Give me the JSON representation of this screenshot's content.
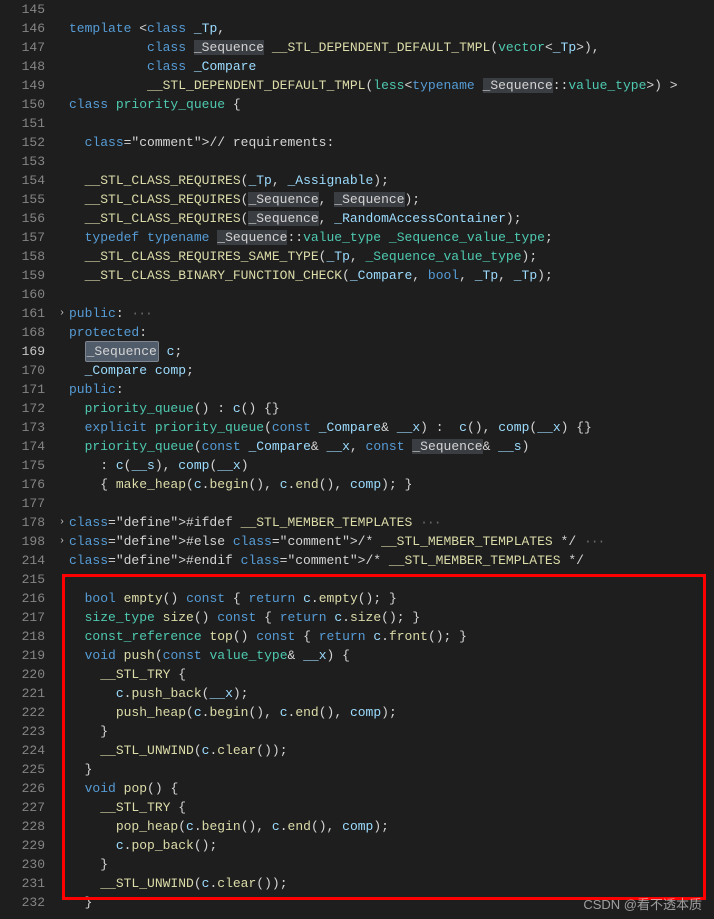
{
  "line_numbers": [
    145,
    146,
    147,
    148,
    149,
    150,
    151,
    152,
    153,
    154,
    155,
    156,
    157,
    158,
    159,
    160,
    161,
    168,
    169,
    170,
    171,
    172,
    173,
    174,
    175,
    176,
    177,
    178,
    198,
    214,
    215,
    216,
    217,
    218,
    219,
    220,
    221,
    222,
    223,
    224,
    225,
    226,
    227,
    228,
    229,
    230,
    231,
    232
  ],
  "fold_markers": {
    "161": true,
    "178": true,
    "198": true
  },
  "active_line": 169,
  "code_lines": {
    "145": "",
    "146": "template <class _Tp,",
    "147": "          class _Sequence __STL_DEPENDENT_DEFAULT_TMPL(vector<_Tp>),",
    "148": "          class _Compare",
    "149": "          __STL_DEPENDENT_DEFAULT_TMPL(less<typename _Sequence::value_type>) >",
    "150": "class priority_queue {",
    "151": "",
    "152": "  // requirements:",
    "153": "",
    "154": "  __STL_CLASS_REQUIRES(_Tp, _Assignable);",
    "155": "  __STL_CLASS_REQUIRES(_Sequence, _Sequence);",
    "156": "  __STL_CLASS_REQUIRES(_Sequence, _RandomAccessContainer);",
    "157": "  typedef typename _Sequence::value_type _Sequence_value_type;",
    "158": "  __STL_CLASS_REQUIRES_SAME_TYPE(_Tp, _Sequence_value_type);",
    "159": "  __STL_CLASS_BINARY_FUNCTION_CHECK(_Compare, bool, _Tp, _Tp);",
    "160": "",
    "161": "public: ···",
    "168": "protected:",
    "169": "  _Sequence c;",
    "170": "  _Compare comp;",
    "171": "public:",
    "172": "  priority_queue() : c() {}",
    "173": "  explicit priority_queue(const _Compare& __x) :  c(), comp(__x) {}",
    "174": "  priority_queue(const _Compare& __x, const _Sequence& __s)",
    "175": "    : c(__s), comp(__x)",
    "176": "    { make_heap(c.begin(), c.end(), comp); }",
    "177": "",
    "178": "#ifdef __STL_MEMBER_TEMPLATES ···",
    "198": "#else /* __STL_MEMBER_TEMPLATES */ ···",
    "214": "#endif /* __STL_MEMBER_TEMPLATES */",
    "215": "",
    "216": "  bool empty() const { return c.empty(); }",
    "217": "  size_type size() const { return c.size(); }",
    "218": "  const_reference top() const { return c.front(); }",
    "219": "  void push(const value_type& __x) {",
    "220": "    __STL_TRY {",
    "221": "      c.push_back(__x);",
    "222": "      push_heap(c.begin(), c.end(), comp);",
    "223": "    }",
    "224": "    __STL_UNWIND(c.clear());",
    "225": "  }",
    "226": "  void pop() {",
    "227": "    __STL_TRY {",
    "228": "      pop_heap(c.begin(), c.end(), comp);",
    "229": "      c.pop_back();",
    "230": "    }",
    "231": "    __STL_UNWIND(c.clear());",
    "232": "  }"
  },
  "watermark": "CSDN @看不透本质"
}
